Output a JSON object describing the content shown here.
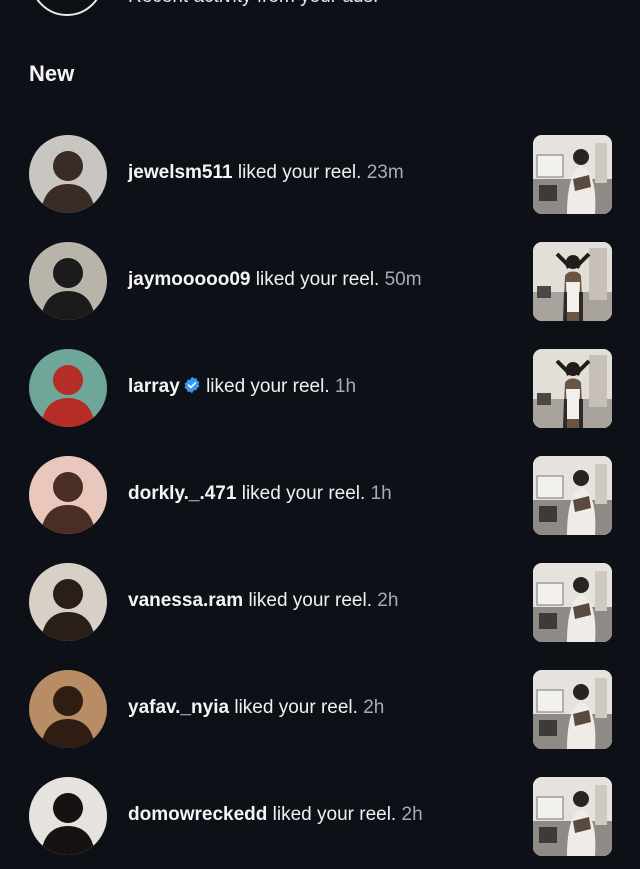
{
  "header": {
    "partial_text": "Recent activity from your ads."
  },
  "section": {
    "title": "New"
  },
  "notifications": [
    {
      "username": "jewelsm511",
      "verified": false,
      "action": "liked your reel.",
      "time": "23m",
      "avatar_bg": "#c9c6c1",
      "avatar_fg": "#3a2b26",
      "thumb": "a"
    },
    {
      "username": "jaymooooo09",
      "verified": false,
      "action": "liked your reel.",
      "time": "50m",
      "avatar_bg": "#b8b4a9",
      "avatar_fg": "#1b1b1b",
      "thumb": "b"
    },
    {
      "username": "larray",
      "verified": true,
      "action": "liked your reel.",
      "time": "1h",
      "avatar_bg": "#6fa69a",
      "avatar_fg": "#b52d25",
      "thumb": "b"
    },
    {
      "username": "dorkly._.471",
      "verified": false,
      "action": "liked your reel.",
      "time": "1h",
      "avatar_bg": "#e9c7bd",
      "avatar_fg": "#4a2d24",
      "thumb": "a"
    },
    {
      "username": "vanessa.ram",
      "verified": false,
      "action": "liked your reel.",
      "time": "2h",
      "avatar_bg": "#d8d0c6",
      "avatar_fg": "#2a1e18",
      "thumb": "a"
    },
    {
      "username": "yafav._nyia",
      "verified": false,
      "action": "liked your reel.",
      "time": "2h",
      "avatar_bg": "#b88c64",
      "avatar_fg": "#2f1c12",
      "thumb": "a"
    },
    {
      "username": "domowreckedd",
      "verified": false,
      "action": "liked your reel.",
      "time": "2h",
      "avatar_bg": "#e6e2de",
      "avatar_fg": "#161212",
      "thumb": "a"
    }
  ],
  "colors": {
    "background": "#0d1016",
    "verified_badge": "#3897f0",
    "time_text": "#a9abb1"
  }
}
